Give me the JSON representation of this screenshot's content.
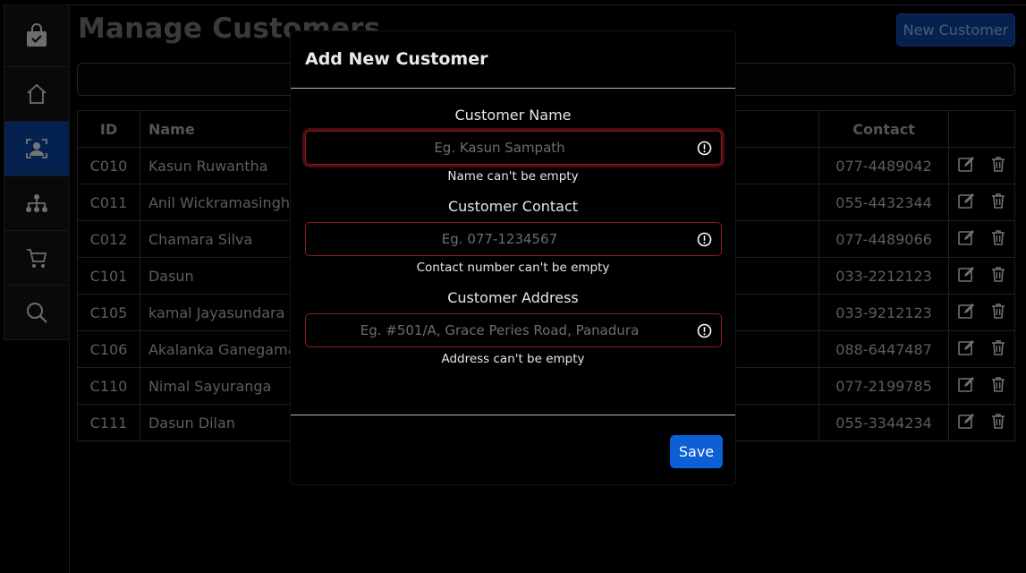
{
  "header": {
    "title": "Manage Customers",
    "new_button": "New Customer"
  },
  "search": {
    "placeholder": ""
  },
  "table": {
    "headers": {
      "id": "ID",
      "name": "Name",
      "contact": "Contact"
    },
    "rows": [
      {
        "id": "C010",
        "name": "Kasun Ruwantha",
        "contact": "077-4489042"
      },
      {
        "id": "C011",
        "name": "Anil Wickramasinghe",
        "contact": "055-4432344"
      },
      {
        "id": "C012",
        "name": "Chamara Silva",
        "contact": "077-4489066"
      },
      {
        "id": "C101",
        "name": "Dasun",
        "contact": "033-2212123"
      },
      {
        "id": "C105",
        "name": "kamal Jayasundara",
        "contact": "033-9212123"
      },
      {
        "id": "C106",
        "name": "Akalanka Ganegama",
        "contact": "088-6447487"
      },
      {
        "id": "C110",
        "name": "Nimal Sayuranga",
        "contact": "077-2199785"
      },
      {
        "id": "C111",
        "name": "Dasun Dilan",
        "contact": "055-3344234"
      }
    ]
  },
  "sidebar": {
    "items": [
      {
        "icon": "shopping-bag-check-icon"
      },
      {
        "icon": "home-icon"
      },
      {
        "icon": "customer-icon",
        "active": true
      },
      {
        "icon": "sitemap-icon"
      },
      {
        "icon": "cart-icon"
      },
      {
        "icon": "search-icon"
      }
    ]
  },
  "modal": {
    "title": "Add New Customer",
    "fields": {
      "name": {
        "label": "Customer Name",
        "placeholder": "Eg. Kasun Sampath",
        "value": "",
        "error": "Name can't be empty"
      },
      "contact": {
        "label": "Customer Contact",
        "placeholder": "Eg. 077-1234567",
        "value": "",
        "error": "Contact number can't be empty"
      },
      "address": {
        "label": "Customer Address",
        "placeholder": "Eg. #501/A, Grace Peries Road, Panadura",
        "value": "",
        "error": "Address can't be empty"
      }
    },
    "save_label": "Save"
  },
  "colors": {
    "accent": "#0d5fd6",
    "sidebar_active": "#0a3d91",
    "error_border": "#8a1c1c"
  }
}
